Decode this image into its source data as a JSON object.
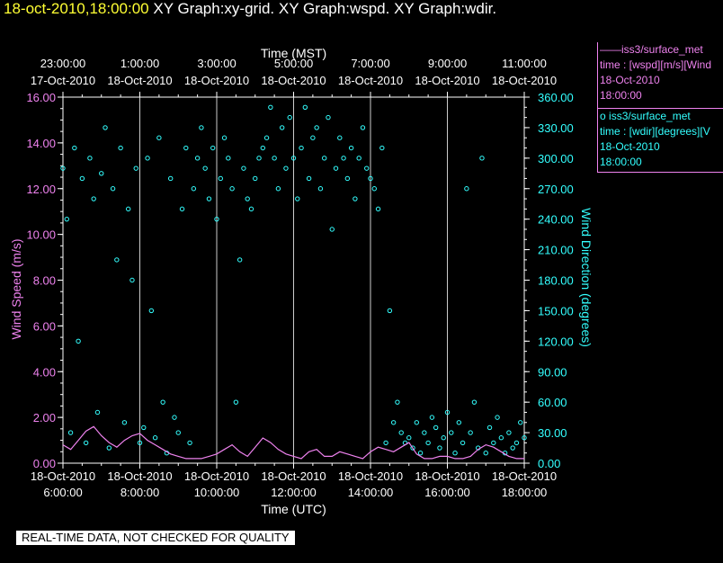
{
  "header": {
    "timestamp": "18-oct-2010,18:00:00",
    "graphs": "XY Graph:xy-grid.  XY Graph:wspd.  XY Graph:wdir."
  },
  "legend": [
    {
      "marker": "——",
      "line1": "iss3/surface_met",
      "line2": "time : [wspd][m/s][Wind",
      "line3": "18-Oct-2010",
      "line4": "18:00:00",
      "color": "#ee82ee"
    },
    {
      "marker": "o",
      "line1": "iss3/surface_met",
      "line2": "time : [wdir][degrees][V",
      "line3": "18-Oct-2010",
      "line4": "18:00:00",
      "color": "#33ffff"
    }
  ],
  "banner": "REAL-TIME DATA, NOT CHECKED FOR QUALITY",
  "chart_data": {
    "type": "scatter",
    "top_axis": {
      "label": "Time (MST)",
      "ticks": [
        {
          "time": "23:00:00",
          "date": "17-Oct-2010"
        },
        {
          "time": "1:00:00",
          "date": "18-Oct-2010"
        },
        {
          "time": "3:00:00",
          "date": "18-Oct-2010"
        },
        {
          "time": "5:00:00",
          "date": "18-Oct-2010"
        },
        {
          "time": "7:00:00",
          "date": "18-Oct-2010"
        },
        {
          "time": "9:00:00",
          "date": "18-Oct-2010"
        },
        {
          "time": "11:00:00",
          "date": "18-Oct-2010"
        }
      ]
    },
    "bottom_axis": {
      "label": "Time (UTC)",
      "ticks": [
        {
          "date": "18-Oct-2010",
          "time": "6:00:00",
          "hour": 6
        },
        {
          "date": "18-Oct-2010",
          "time": "8:00:00",
          "hour": 8
        },
        {
          "date": "18-Oct-2010",
          "time": "10:00:00",
          "hour": 10
        },
        {
          "date": "18-Oct-2010",
          "time": "12:00:00",
          "hour": 12
        },
        {
          "date": "18-Oct-2010",
          "time": "14:00:00",
          "hour": 14
        },
        {
          "date": "18-Oct-2010",
          "time": "16:00:00",
          "hour": 16
        },
        {
          "date": "18-Oct-2010",
          "time": "18:00:00",
          "hour": 18
        }
      ],
      "xlim_hours_utc": [
        6,
        18
      ]
    },
    "left_axis": {
      "label": "Wind Speed (m/s)",
      "ticks": [
        "0.00",
        "2.00",
        "4.00",
        "6.00",
        "8.00",
        "10.00",
        "12.00",
        "14.00",
        "16.00"
      ],
      "ylim": [
        0,
        16
      ],
      "color": "#ee82ee"
    },
    "right_axis": {
      "label": "Wind Direction (degrees)",
      "ticks": [
        "0.00",
        "30.00",
        "60.00",
        "90.00",
        "120.00",
        "150.00",
        "180.00",
        "210.00",
        "240.00",
        "270.00",
        "300.00",
        "330.00",
        "360.00"
      ],
      "ylim": [
        0,
        360
      ],
      "color": "#33ffff"
    },
    "grid": true,
    "series": [
      {
        "name": "iss3/surface_met time : [wspd][m/s]",
        "style": "line",
        "axis": "left",
        "color": "#ee82ee",
        "x": [
          6.0,
          6.2,
          6.4,
          6.6,
          6.8,
          7.0,
          7.2,
          7.4,
          7.6,
          7.8,
          8.0,
          8.2,
          8.4,
          8.6,
          8.8,
          9.0,
          9.2,
          9.4,
          9.6,
          9.8,
          10.0,
          10.2,
          10.4,
          10.6,
          10.8,
          11.0,
          11.2,
          11.4,
          11.6,
          11.8,
          12.0,
          12.2,
          12.4,
          12.6,
          12.8,
          13.0,
          13.2,
          13.4,
          13.6,
          13.8,
          14.0,
          14.2,
          14.4,
          14.6,
          14.8,
          15.0,
          15.2,
          15.4,
          15.6,
          15.8,
          16.0,
          16.2,
          16.4,
          16.6,
          16.8,
          17.0,
          17.2,
          17.4,
          17.6,
          17.8,
          18.0
        ],
        "y": [
          0.8,
          0.6,
          1.0,
          1.4,
          1.6,
          1.2,
          0.9,
          0.7,
          1.0,
          1.2,
          1.3,
          1.0,
          0.8,
          0.6,
          0.4,
          0.3,
          0.2,
          0.2,
          0.2,
          0.3,
          0.4,
          0.6,
          0.8,
          0.5,
          0.3,
          0.7,
          1.1,
          0.9,
          0.6,
          0.4,
          0.3,
          0.2,
          0.5,
          0.6,
          0.3,
          0.3,
          0.5,
          0.4,
          0.3,
          0.2,
          0.5,
          0.7,
          0.6,
          0.5,
          0.7,
          0.9,
          0.4,
          0.2,
          0.2,
          0.3,
          0.3,
          0.2,
          0.2,
          0.3,
          0.6,
          0.8,
          0.7,
          0.5,
          0.3,
          0.2,
          0.2
        ]
      },
      {
        "name": "iss3/surface_met time : [wdir][degrees]",
        "style": "markers",
        "axis": "right",
        "color": "#33ffff",
        "x": [
          6.0,
          6.1,
          6.2,
          6.3,
          6.4,
          6.5,
          6.6,
          6.7,
          6.8,
          6.9,
          7.0,
          7.1,
          7.2,
          7.3,
          7.4,
          7.5,
          7.6,
          7.7,
          7.8,
          7.9,
          8.0,
          8.1,
          8.2,
          8.3,
          8.4,
          8.5,
          8.6,
          8.7,
          8.8,
          8.9,
          9.0,
          9.1,
          9.2,
          9.3,
          9.4,
          9.5,
          9.6,
          9.7,
          9.8,
          9.9,
          10.0,
          10.1,
          10.2,
          10.3,
          10.4,
          10.5,
          10.6,
          10.7,
          10.8,
          10.9,
          11.0,
          11.1,
          11.2,
          11.3,
          11.4,
          11.5,
          11.6,
          11.7,
          11.8,
          11.9,
          12.0,
          12.1,
          12.2,
          12.3,
          12.4,
          12.5,
          12.6,
          12.7,
          12.8,
          12.9,
          13.0,
          13.1,
          13.2,
          13.3,
          13.4,
          13.5,
          13.6,
          13.7,
          13.8,
          13.9,
          14.0,
          14.1,
          14.2,
          14.3,
          14.4,
          14.5,
          14.6,
          14.7,
          14.8,
          14.9,
          15.0,
          15.1,
          15.2,
          15.3,
          15.4,
          15.5,
          15.6,
          15.7,
          15.8,
          15.9,
          16.0,
          16.1,
          16.2,
          16.3,
          16.4,
          16.5,
          16.6,
          16.7,
          16.8,
          16.9,
          17.0,
          17.1,
          17.2,
          17.3,
          17.4,
          17.5,
          17.6,
          17.7,
          17.8,
          17.9,
          18.0
        ],
        "y": [
          290,
          240,
          30,
          310,
          120,
          280,
          20,
          300,
          260,
          50,
          285,
          330,
          15,
          270,
          200,
          310,
          40,
          250,
          180,
          290,
          20,
          35,
          300,
          150,
          25,
          320,
          60,
          10,
          280,
          45,
          30,
          250,
          310,
          20,
          270,
          300,
          330,
          290,
          260,
          310,
          240,
          280,
          320,
          300,
          270,
          60,
          200,
          290,
          260,
          250,
          280,
          300,
          310,
          320,
          350,
          300,
          270,
          330,
          290,
          340,
          300,
          260,
          310,
          350,
          280,
          320,
          330,
          270,
          300,
          340,
          230,
          290,
          320,
          300,
          280,
          310,
          260,
          300,
          330,
          290,
          280,
          270,
          250,
          310,
          20,
          150,
          40,
          60,
          30,
          20,
          25,
          15,
          40,
          10,
          30,
          20,
          45,
          35,
          15,
          25,
          50,
          30,
          10,
          40,
          20,
          270,
          30,
          60,
          15,
          300,
          10,
          35,
          20,
          45,
          25,
          10,
          30,
          15,
          20,
          40,
          25
        ]
      }
    ]
  }
}
